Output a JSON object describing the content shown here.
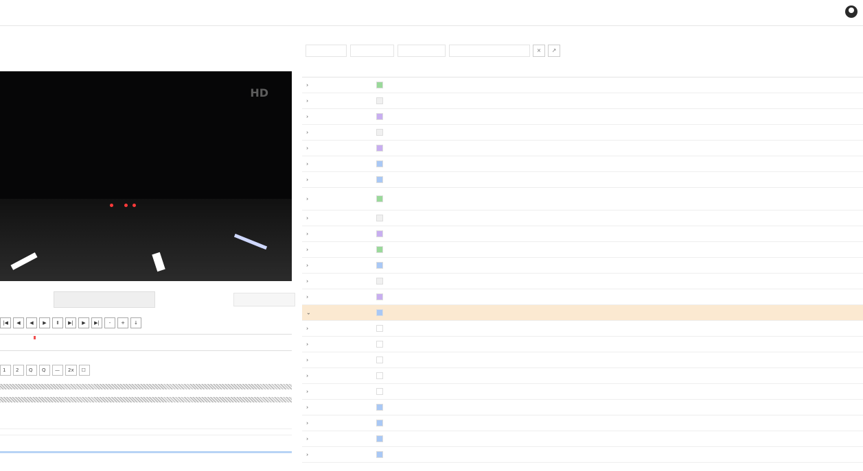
{
  "top": {
    "nav": [
      "",
      "",
      ""
    ],
    "user": ""
  },
  "left": {
    "title": "",
    "hd_badge": "HD",
    "main_button": "",
    "frame_info": "",
    "timeline_label": "",
    "bottom_time": ""
  },
  "filters": {
    "first": "",
    "second": "",
    "third": "",
    "search_placeholder": ""
  },
  "table": {
    "headers": [
      "",
      "",
      "",
      "",
      "",
      ""
    ],
    "rows": [
      {
        "time": "",
        "color": "#9ad99a",
        "id": "",
        "text": "",
        "right": "",
        "kind": "plain"
      },
      {
        "time": "",
        "color": "#f0f0f0",
        "id": "",
        "text": "",
        "right": "",
        "kind": "plain"
      },
      {
        "time": "",
        "color": "#c8aef0",
        "id": "",
        "text": "",
        "right": "",
        "kind": "blue"
      },
      {
        "time": "",
        "color": "#f0f0f0",
        "id": "",
        "text": "",
        "right": "",
        "kind": "plain"
      },
      {
        "time": "",
        "color": "#c8aef0",
        "id": "",
        "text": "",
        "right": "",
        "kind": "blue"
      },
      {
        "time": "",
        "color": "#a9c8f5",
        "id": "",
        "text": "",
        "right": "",
        "kind": "green"
      },
      {
        "time": "",
        "color": "#a9c8f5",
        "id": "",
        "text": "",
        "right": "",
        "kind": "green"
      },
      {
        "time": "",
        "color": "#9ad99a",
        "id": "",
        "text": "",
        "right": "",
        "kind": "plain"
      },
      {
        "time": "",
        "color": "#f0f0f0",
        "id": "",
        "text": "",
        "right": "",
        "kind": "plain"
      },
      {
        "time": "",
        "color": "#c8aef0",
        "id": "",
        "text": "",
        "right": "",
        "kind": "blue"
      },
      {
        "time": "",
        "color": "#9ad99a",
        "id": "",
        "text": "",
        "right": "",
        "kind": "plain"
      },
      {
        "time": "",
        "color": "#a9c8f5",
        "id": "",
        "text": "",
        "right": "",
        "kind": "green"
      },
      {
        "time": "",
        "color": "#f0f0f0",
        "id": "",
        "text": "",
        "right": "",
        "kind": "plain"
      },
      {
        "time": "",
        "color": "#c8aef0",
        "id": "",
        "text": "",
        "right": "",
        "kind": "blue"
      },
      {
        "time": "",
        "color": "#a9c8f5",
        "id": "",
        "text": "",
        "right": "",
        "kind": "green",
        "selected": true
      },
      {
        "time": "",
        "color": "#ffffff",
        "id": "",
        "text": "",
        "right": "",
        "kind": "plain"
      },
      {
        "time": "",
        "color": "#ffffff",
        "id": "",
        "text": "",
        "right": "",
        "kind": "plain"
      },
      {
        "time": "",
        "color": "#ffffff",
        "id": "",
        "text": "",
        "right": "",
        "kind": "plain"
      },
      {
        "time": "",
        "color": "#ffffff",
        "id": "",
        "text": "",
        "right": "",
        "kind": "plain"
      },
      {
        "time": "",
        "color": "#ffffff",
        "id": "",
        "text": "",
        "right": "",
        "kind": "plain"
      },
      {
        "time": "",
        "color": "#a9c8f5",
        "id": "",
        "text": "",
        "right": "",
        "kind": "green"
      },
      {
        "time": "",
        "color": "#a9c8f5",
        "id": "",
        "text": "",
        "right": "",
        "kind": "green"
      },
      {
        "time": "",
        "color": "#a9c8f5",
        "id": "",
        "text": "",
        "right": "",
        "kind": "green"
      },
      {
        "time": "",
        "color": "#a9c8f5",
        "id": "",
        "text": "",
        "right": "",
        "kind": "green"
      }
    ]
  }
}
